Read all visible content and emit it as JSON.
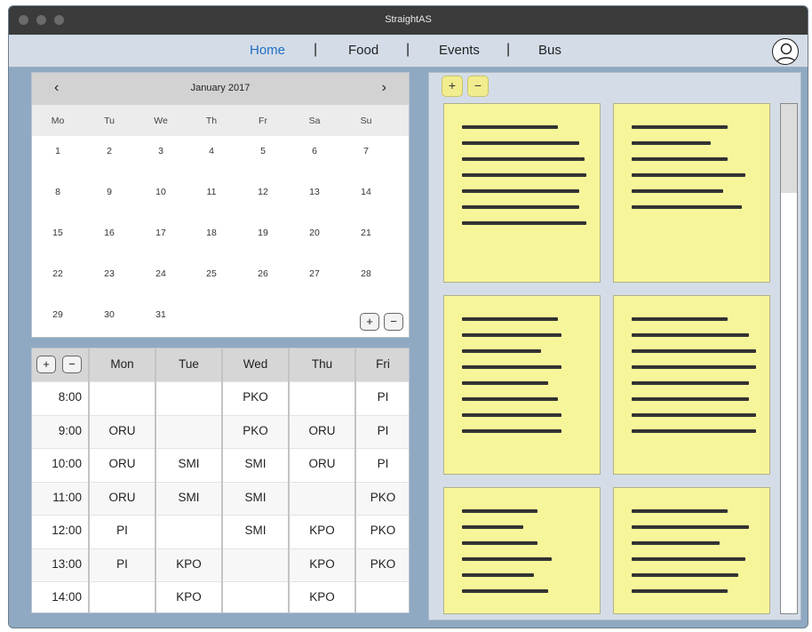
{
  "window": {
    "title": "StraightAS"
  },
  "nav": {
    "items": [
      {
        "label": "Home",
        "active": true
      },
      {
        "label": "Food",
        "active": false
      },
      {
        "label": "Events",
        "active": false
      },
      {
        "label": "Bus",
        "active": false
      }
    ],
    "separator": "|",
    "avatar_icon": "user-avatar-icon"
  },
  "calendar": {
    "prev": "‹",
    "next": "›",
    "month": "January 2017",
    "day_names": [
      "Mo",
      "Tu",
      "We",
      "Th",
      "Fr",
      "Sa",
      "Su"
    ],
    "weeks": [
      [
        "1",
        "2",
        "3",
        "4",
        "5",
        "6",
        "7"
      ],
      [
        "8",
        "9",
        "10",
        "11",
        "12",
        "13",
        "14"
      ],
      [
        "15",
        "16",
        "17",
        "18",
        "19",
        "20",
        "21"
      ],
      [
        "22",
        "23",
        "24",
        "25",
        "26",
        "27",
        "28"
      ],
      [
        "29",
        "30",
        "31",
        "",
        "",
        "",
        ""
      ]
    ],
    "add_label": "+",
    "remove_label": "−"
  },
  "timetable": {
    "add_label": "+",
    "remove_label": "−",
    "days": [
      "Mon",
      "Tue",
      "Wed",
      "Thu",
      "Fri"
    ],
    "rows": [
      {
        "time": "8:00",
        "cells": [
          "",
          "",
          "PKO",
          "",
          "PI"
        ]
      },
      {
        "time": "9:00",
        "cells": [
          "ORU",
          "",
          "PKO",
          "ORU",
          "PI"
        ]
      },
      {
        "time": "10:00",
        "cells": [
          "ORU",
          "SMI",
          "SMI",
          "ORU",
          "PI"
        ]
      },
      {
        "time": "11:00",
        "cells": [
          "ORU",
          "SMI",
          "SMI",
          "",
          "PKO"
        ]
      },
      {
        "time": "12:00",
        "cells": [
          "PI",
          "",
          "SMI",
          "KPO",
          "PKO"
        ]
      },
      {
        "time": "13:00",
        "cells": [
          "PI",
          "KPO",
          "",
          "KPO",
          "PKO"
        ]
      },
      {
        "time": "14:00",
        "cells": [
          "",
          "KPO",
          "",
          "KPO",
          ""
        ]
      }
    ]
  },
  "notes": {
    "add_label": "+",
    "remove_label": "−",
    "note_color": "#f7f59a",
    "items": [
      {
        "lines": [
          0.55,
          0.67,
          0.7,
          0.71,
          0.67,
          0.67,
          0.71
        ]
      },
      {
        "lines": [
          0.55,
          0.45,
          0.55,
          0.65,
          0.52,
          0.63
        ]
      },
      {
        "lines": [
          0.55,
          0.57,
          0.45,
          0.57,
          0.49,
          0.55,
          0.57,
          0.57
        ]
      },
      {
        "lines": [
          0.55,
          0.67,
          0.71,
          0.71,
          0.67,
          0.67,
          0.71,
          0.71
        ]
      },
      {
        "lines": [
          0.43,
          0.35,
          0.43,
          0.51,
          0.41,
          0.49
        ]
      },
      {
        "lines": [
          0.55,
          0.67,
          0.5,
          0.65,
          0.61,
          0.55
        ]
      }
    ]
  }
}
